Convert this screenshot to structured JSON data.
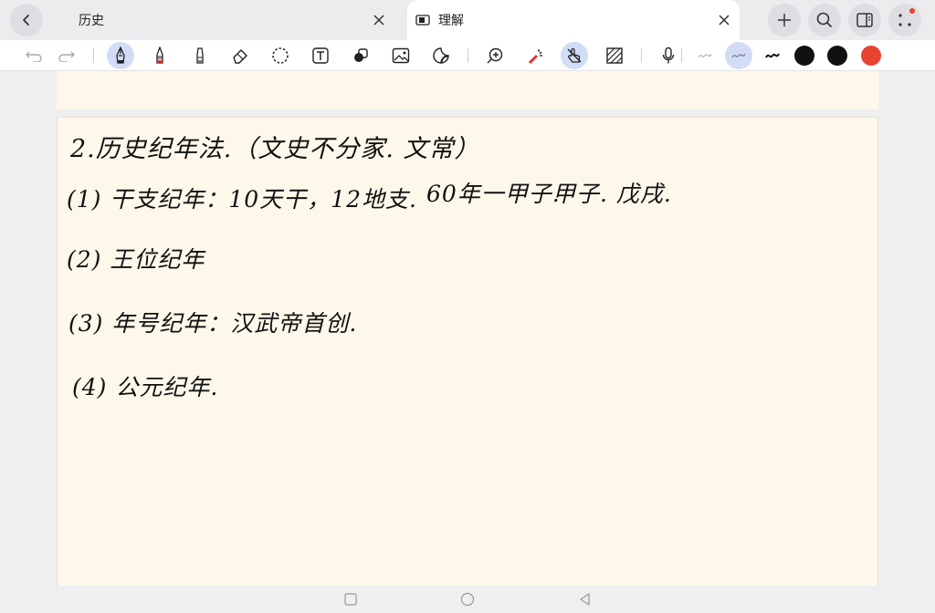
{
  "tabs": [
    {
      "label": "历史",
      "active": false
    },
    {
      "label": "理解",
      "active": true
    }
  ],
  "toolbar": {
    "colors": [
      "#111111",
      "#111111",
      "#e8432e"
    ]
  },
  "notes": {
    "line1": "2.历史纪年法.（文史不分家. 文常）",
    "line2a": "(1) 干支纪年：10天干，12地支.",
    "line2b": "60年一甲子.",
    "line2c": "甲子. 戊戌.",
    "line3": "(2) 王位纪年",
    "line4": "(3) 年号纪年：汉武帝首创.",
    "line5": "(4) 公元纪年."
  }
}
